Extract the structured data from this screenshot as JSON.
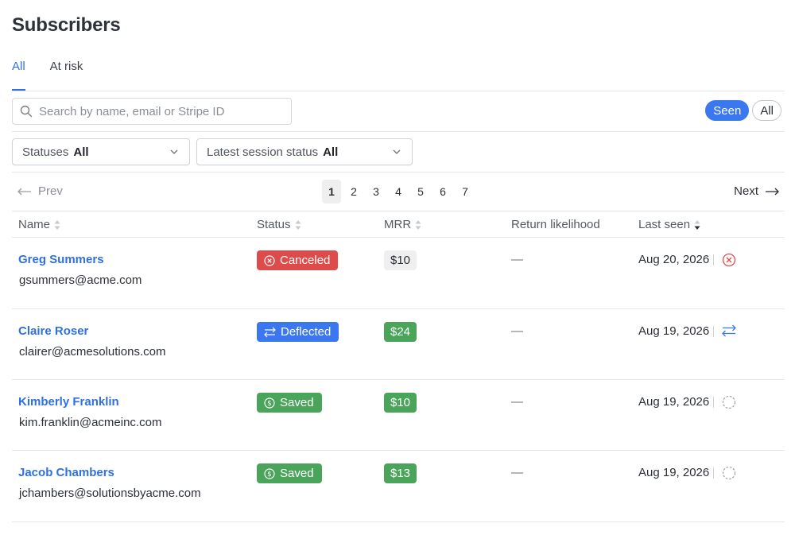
{
  "page": {
    "title": "Subscribers"
  },
  "tabs": [
    {
      "label": "All",
      "active": true
    },
    {
      "label": "At risk",
      "active": false
    }
  ],
  "search": {
    "placeholder": "Search by name, email or Stripe ID",
    "value": ""
  },
  "seen_toggle": {
    "on_label": "Seen",
    "off_label": "All"
  },
  "filters": [
    {
      "label": "Statuses",
      "value": "All"
    },
    {
      "label": "Latest session status",
      "value": "All"
    }
  ],
  "pagination": {
    "prev": "Prev",
    "next": "Next",
    "pages": [
      "1",
      "2",
      "3",
      "4",
      "5",
      "6",
      "7"
    ],
    "current": "1"
  },
  "columns": {
    "name": "Name",
    "status": "Status",
    "mrr": "MRR",
    "likelihood": "Return likelihood",
    "last_seen": "Last seen"
  },
  "colors": {
    "accent": "#3170e8",
    "canceled": "#dd4b4b",
    "deflected": "#3b78ef",
    "saved": "#4aa45a",
    "neutral_chip": "#efefef"
  },
  "rows": [
    {
      "name": "Greg Summers",
      "email": "gsummers@acme.com",
      "status": "Canceled",
      "status_icon": "x-circle-icon",
      "mrr": "$10",
      "mrr_style": "neutral",
      "likelihood": "—",
      "last_seen": "Aug 20, 2026",
      "action_icon": "x-circle-icon"
    },
    {
      "name": "Claire Roser",
      "email": "clairer@acmesolutions.com",
      "status": "Deflected",
      "status_icon": "swap-arrows-icon",
      "mrr": "$24",
      "mrr_style": "saved",
      "likelihood": "—",
      "last_seen": "Aug 19, 2026",
      "action_icon": "swap-arrows-icon"
    },
    {
      "name": "Kimberly Franklin",
      "email": "kim.franklin@acmeinc.com",
      "status": "Saved",
      "status_icon": "dollar-circle-icon",
      "mrr": "$10",
      "mrr_style": "saved",
      "likelihood": "—",
      "last_seen": "Aug 19, 2026",
      "action_icon": "dashed-circle-icon"
    },
    {
      "name": "Jacob Chambers",
      "email": "jchambers@solutionsbyacme.com",
      "status": "Saved",
      "status_icon": "dollar-circle-icon",
      "mrr": "$13",
      "mrr_style": "saved",
      "likelihood": "—",
      "last_seen": "Aug 19, 2026",
      "action_icon": "dashed-circle-icon"
    }
  ]
}
